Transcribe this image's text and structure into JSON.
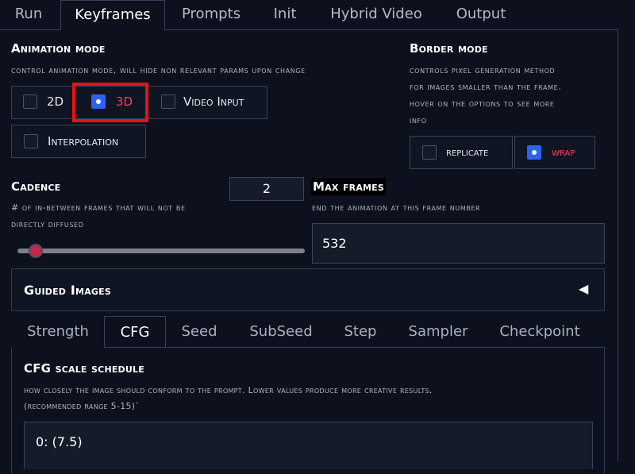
{
  "top_tabs": [
    "Run",
    "Keyframes",
    "Prompts",
    "Init",
    "Hybrid Video",
    "Output"
  ],
  "animation_mode": {
    "title": "Animation mode",
    "info": "control animation mode, will hide non relevant params upon change",
    "options": [
      "2D",
      "3D",
      "Video Input",
      "Interpolation"
    ],
    "selected": "3D"
  },
  "border_mode": {
    "title": "Border mode",
    "info_lines": [
      "controls pixel generation method",
      "for images smaller than the frame.",
      "hover on the options to see more",
      "info"
    ],
    "options": [
      "replicate",
      "wrap"
    ],
    "selected": "wrap"
  },
  "cadence": {
    "title": "Cadence",
    "value": "2",
    "info_lines": [
      "# of in-between frames that will not be",
      "directly diffused"
    ],
    "slider_fraction": 0.04
  },
  "max_frames": {
    "title": "Max frames",
    "info": "end the animation at this frame number",
    "value": "532"
  },
  "guided_images": {
    "title": "Guided Images",
    "toggle_icon": "◀"
  },
  "sub_tabs": [
    "Strength",
    "CFG",
    "Seed",
    "SubSeed",
    "Step",
    "Sampler",
    "Checkpoint"
  ],
  "active_sub_tab": "CFG",
  "cfg": {
    "title": "CFG scale schedule",
    "info_lines": [
      "how closely the image should conform to the prompt. Lower values produce more creative results.",
      "(recommended range 5-15)`"
    ],
    "value": "0: (7.5)"
  },
  "colors": {
    "accent": "#2b63f0",
    "selected_text": "#ff3b62",
    "highlight_box": "#e8101a",
    "slider_thumb": "#c8254b"
  }
}
